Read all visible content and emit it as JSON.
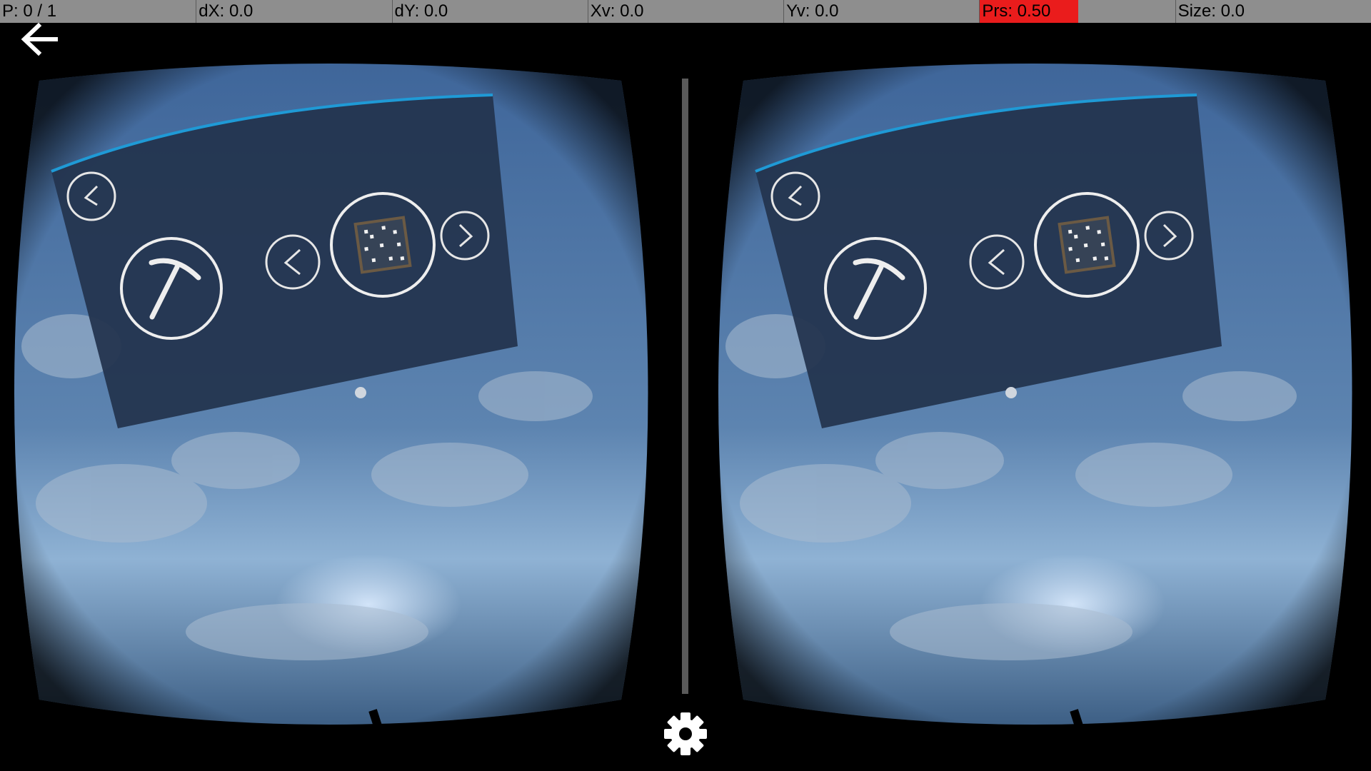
{
  "debug": {
    "p": "P: 0 / 1",
    "dx": "dX: 0.0",
    "dy": "dY: 0.0",
    "xv": "Xv: 0.0",
    "yv": "Yv: 0.0",
    "prs": "Prs: 0.50",
    "size": "Size: 0.0",
    "highlight_color": "#ea1c1c"
  },
  "icons": {
    "back": "arrow-left-icon",
    "settings": "gear-icon",
    "tool": "pickaxe-icon",
    "block": "block-icon"
  },
  "colors": {
    "panel": "#24354f",
    "sky": "#5b7ea8",
    "panel_edge": "#1f9ad6"
  }
}
